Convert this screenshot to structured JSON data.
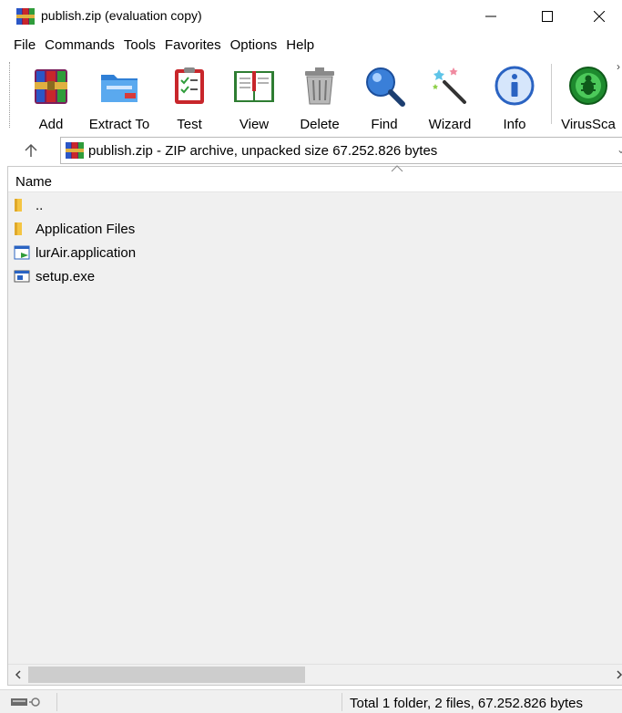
{
  "window": {
    "title": "publish.zip (evaluation copy)",
    "minimize_icon": "minimize-icon",
    "maximize_icon": "maximize-icon",
    "close_icon": "close-icon"
  },
  "menu": [
    "File",
    "Commands",
    "Tools",
    "Favorites",
    "Options",
    "Help"
  ],
  "toolbar": {
    "add": "Add",
    "extract": "Extract To",
    "test": "Test",
    "view": "View",
    "delete": "Delete",
    "find": "Find",
    "wizard": "Wizard",
    "info": "Info",
    "virus": "VirusSca"
  },
  "address": {
    "text": "publish.zip - ZIP archive, unpacked size 67.252.826 bytes"
  },
  "list": {
    "column_name": "Name",
    "rows": [
      {
        "name": "..",
        "icon": "folder-icon"
      },
      {
        "name": "Application Files",
        "icon": "folder-icon"
      },
      {
        "name": "lurAir.application",
        "icon": "application-manifest-icon"
      },
      {
        "name": "setup.exe",
        "icon": "exe-icon"
      }
    ]
  },
  "status": {
    "text": "Total 1 folder, 2 files, 67.252.826 bytes"
  },
  "colors": {
    "folder": "#f5c542",
    "scroll_thumb": "#cdcdcd",
    "status_bg": "#f0f0f0"
  }
}
